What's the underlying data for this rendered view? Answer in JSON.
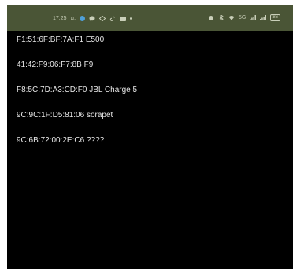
{
  "status_bar": {
    "time": "17:25",
    "time_suffix": "ม.",
    "network": "5G",
    "battery": "86"
  },
  "devices": [
    {
      "address": "F1:51:6F:BF:7A:F1",
      "name": "E500"
    },
    {
      "address": "41:42:F9:06:F7:8B",
      "name": "F9"
    },
    {
      "address": "F8:5C:7D:A3:CD:F0",
      "name": "JBL Charge 5"
    },
    {
      "address": "9C:9C:1F:D5:81:06",
      "name": "sorapet"
    },
    {
      "address": "9C:6B:72:00:2E:C6",
      "name": "????"
    }
  ],
  "colors": {
    "status_bar_bg": "#4a5536",
    "screen_bg": "#000000",
    "text": "#e8e8e8"
  }
}
